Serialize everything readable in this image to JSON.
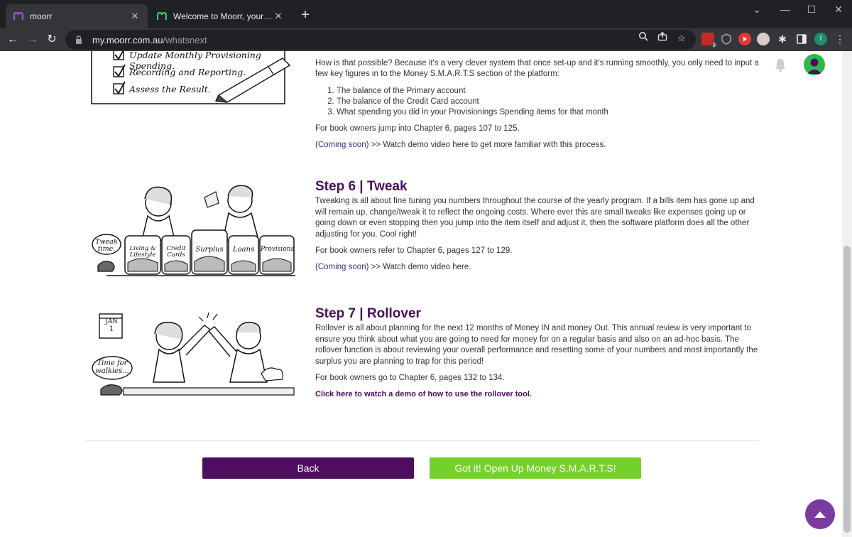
{
  "browser": {
    "tabs": [
      {
        "title": "moorr",
        "active": true
      },
      {
        "title": "Welcome to Moorr, your Lifestyle by",
        "active": false
      }
    ],
    "url_host": "my.moorr.com.au",
    "url_path": "/whatsnext",
    "extension_badge": "9",
    "profile_initial": "I"
  },
  "step5": {
    "checklist": [
      "Update Monthly Provisioning Spending.",
      "Recording and Reporting.",
      "Assess the Result."
    ],
    "intro": "How is that possible? Because it's a very clever system that once set-up and it's running smoothly, you only need to input a few key figures in to the Money S.M.A.R.T.S section of the platform:",
    "items": [
      "The balance of the Primary account",
      "The balance of the Credit Card account",
      "What spending you did in your Provisionings Spending items for that month"
    ],
    "book": "For book owners jump into Chapter 6, pages 107 to 125.",
    "coming_soon": "(Coming soon)",
    "demo": ">> Watch demo video here to get more familiar with this process."
  },
  "step6": {
    "title": "Step 6 | Tweak",
    "body": "Tweaking is all about fine tuning you numbers throughout the course of the yearly program. If a bills item has gone up and will remain up, change/tweak it to reflect the ongoing costs. Where ever this are small tweaks like expenses going up or going down or even stopping then you jump into the item itself and adjust it, then the software platform does all the other adjusting for you. Cool right!",
    "book": "For book owners refer to Chapter 6, pages 127 to 129.",
    "coming_soon": "(Coming soon)",
    "demo": ">> Watch demo video here.",
    "jars": [
      "Living & Lifestyle",
      "Credit Cards",
      "Surplus",
      "Loans",
      "Provisions"
    ],
    "bubble": "Tweak time."
  },
  "step7": {
    "title": "Step 7 | Rollover",
    "body": "Rollover is all about planning for the next 12 months of Money IN and money Out. This annual review is very important to ensure you think about what you are going to need for money for on a regular basis and also on an ad-hoc basis. The rollover function is about reviewing your overall performance and resetting some of your numbers and most importantly the surplus you are planning to trap for this period!",
    "book": "For book owners go to Chapter 6, pages 132 to 134.",
    "link": "Click here to watch a demo of how to use the rollover tool.",
    "calendar_month": "JAN",
    "calendar_day": "1",
    "bubble": "Time for walkies..."
  },
  "buttons": {
    "back": "Back",
    "open": "Got it! Open Up Money S.M.A.R.T.S!"
  },
  "colors": {
    "brand_purple": "#4f0d60",
    "accent_green": "#74d12a",
    "title_purple": "#4a0e5c",
    "fab_purple": "#7b3aa0"
  }
}
